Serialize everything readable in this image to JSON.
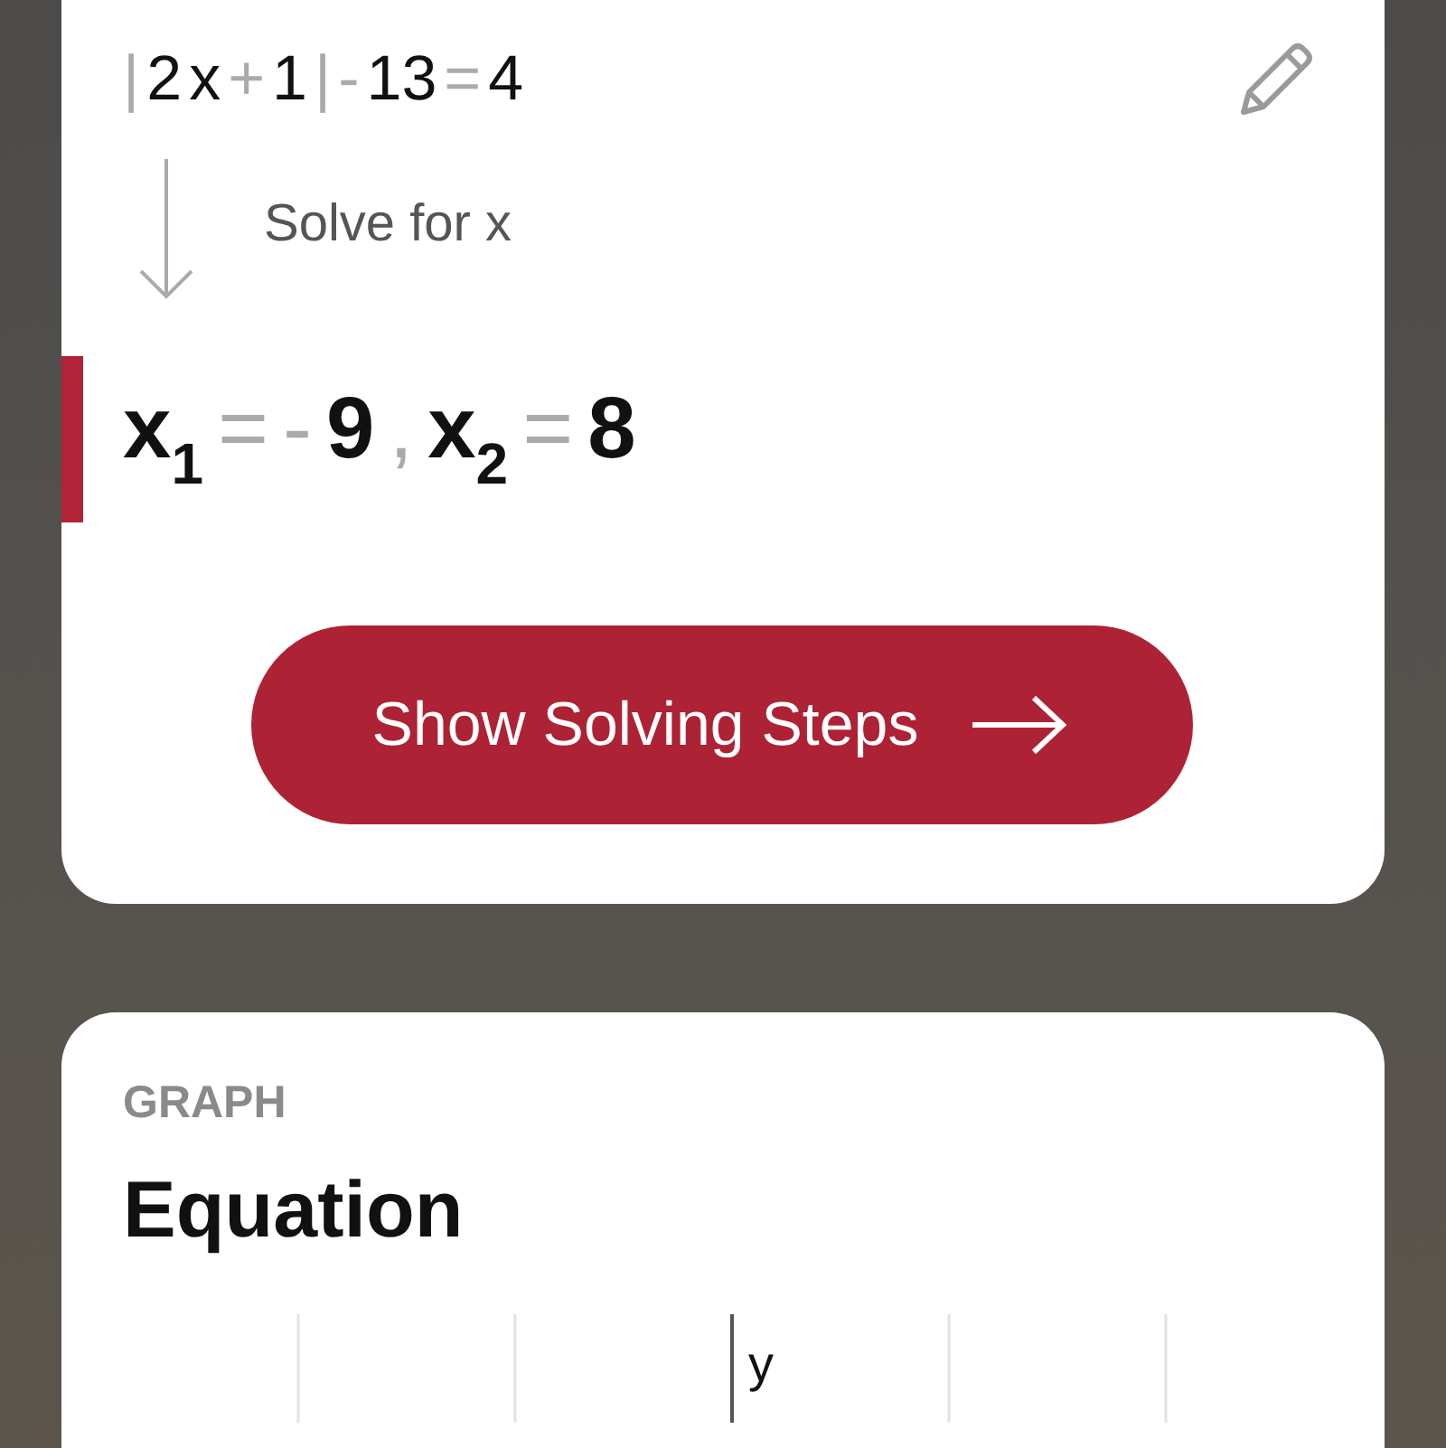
{
  "problem": {
    "equation": [
      {
        "text": "|",
        "kind": "operator"
      },
      {
        "text": "2",
        "kind": "term"
      },
      {
        "text": "x",
        "kind": "term"
      },
      {
        "text": "+",
        "kind": "operator"
      },
      {
        "text": "1",
        "kind": "term"
      },
      {
        "text": "|",
        "kind": "operator"
      },
      {
        "text": "-",
        "kind": "operator"
      },
      {
        "text": "13",
        "kind": "term"
      },
      {
        "text": "=",
        "kind": "operator"
      },
      {
        "text": "4",
        "kind": "term"
      }
    ],
    "step_label": "Solve for x",
    "answer": [
      {
        "text": "x$_{1}$",
        "kind": "term"
      },
      {
        "text": "=",
        "kind": "operator"
      },
      {
        "text": "-",
        "kind": "operator"
      },
      {
        "text": "9",
        "kind": "term"
      },
      {
        "text": ",",
        "kind": "operator"
      },
      {
        "text": "x$_{2}$",
        "kind": "term"
      },
      {
        "text": "=",
        "kind": "operator"
      },
      {
        "text": "8",
        "kind": "term"
      }
    ],
    "button": "Show Solving Steps"
  },
  "graph": {
    "section": "GRAPH",
    "title": "Equation",
    "axis_label": "y"
  }
}
